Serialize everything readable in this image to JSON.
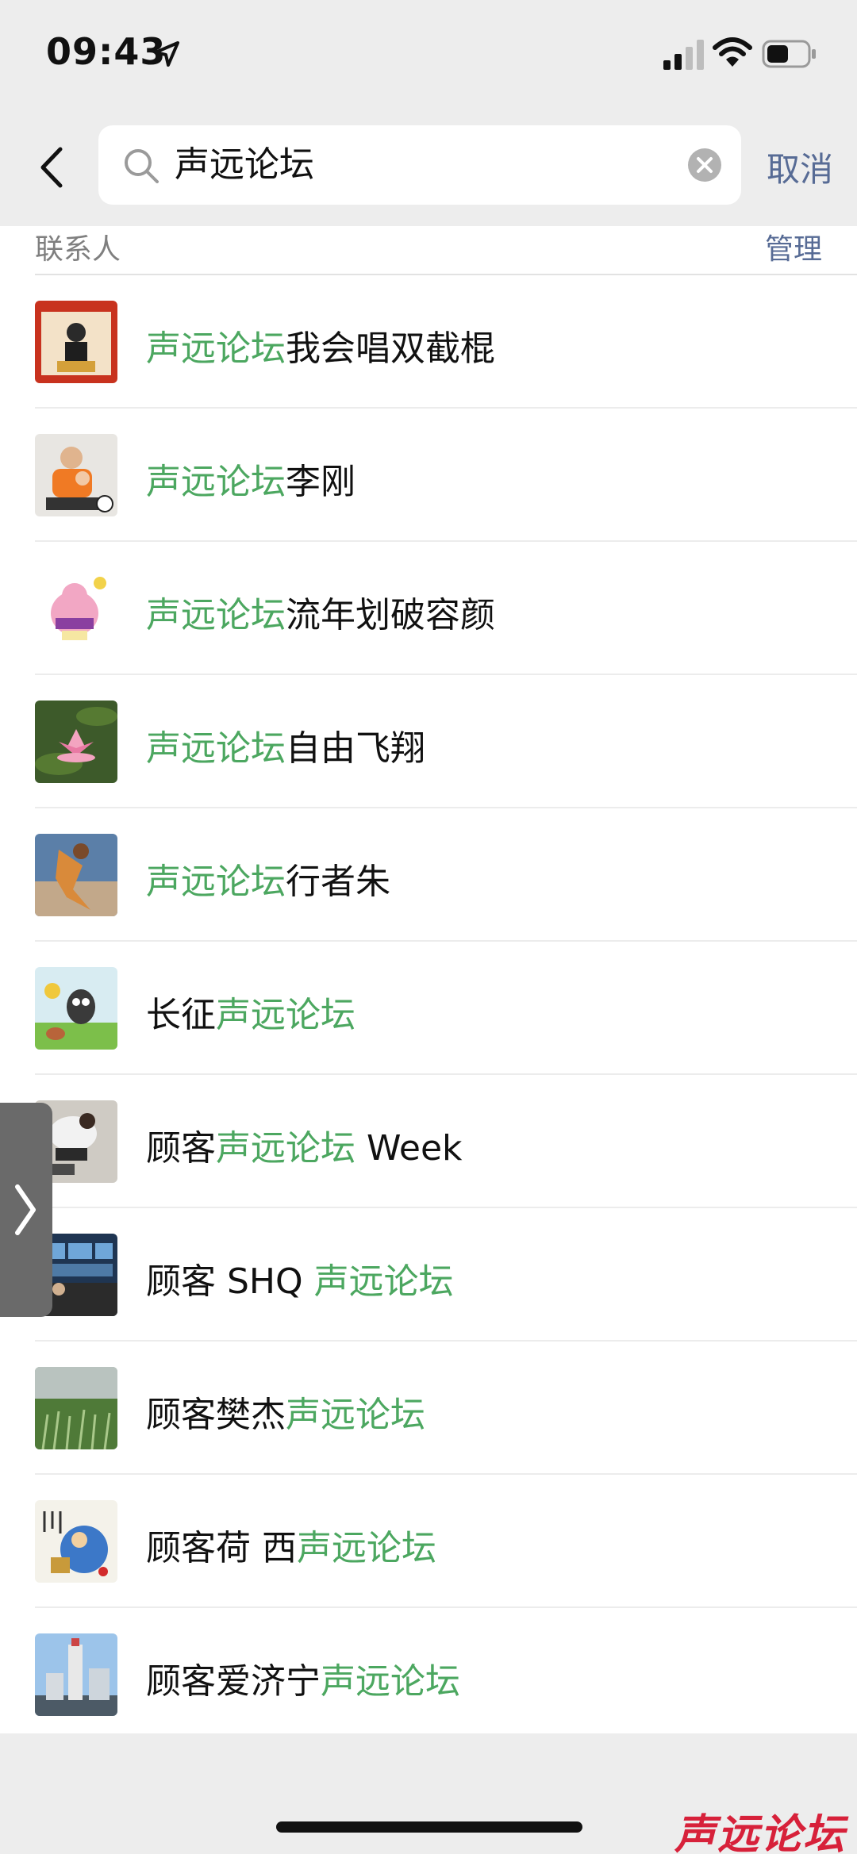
{
  "status_bar": {
    "time": "09:43"
  },
  "search": {
    "query": "声远论坛",
    "cancel_label": "取消"
  },
  "section": {
    "title": "联系人",
    "manage_label": "管理"
  },
  "contacts": [
    {
      "prefix": "",
      "highlight": "声远论坛",
      "suffix": "我会唱双截棍",
      "avatar": "red-portrait"
    },
    {
      "prefix": "",
      "highlight": "声远论坛",
      "suffix": "李刚",
      "avatar": "child-with-ball"
    },
    {
      "prefix": "",
      "highlight": "声远论坛",
      "suffix": "流年划破容颜",
      "avatar": "cartoon-character"
    },
    {
      "prefix": "",
      "highlight": "声远论坛",
      "suffix": "自由飞翔",
      "avatar": "lotus-flower"
    },
    {
      "prefix": "",
      "highlight": "声远论坛",
      "suffix": "行者朱",
      "avatar": "action-photo"
    },
    {
      "prefix": "长征",
      "highlight": "声远论坛",
      "suffix": "",
      "avatar": "cartoon-mole"
    },
    {
      "prefix": "顾客",
      "highlight": "声远论坛",
      "suffix": " Week",
      "avatar": "person-crouching"
    },
    {
      "prefix": "顾客 SHQ ",
      "highlight": "声远论坛",
      "suffix": "",
      "avatar": "control-room"
    },
    {
      "prefix": "顾客樊杰",
      "highlight": "声远论坛",
      "suffix": "",
      "avatar": "grass-field"
    },
    {
      "prefix": "顾客荷 西",
      "highlight": "声远论坛",
      "suffix": "",
      "avatar": "ink-painting"
    },
    {
      "prefix": "顾客爱济宁",
      "highlight": "声远论坛",
      "suffix": "",
      "avatar": "city-tower"
    }
  ],
  "watermark": "声远论坛",
  "colors": {
    "highlight": "#4ca760",
    "link": "#576b95",
    "background": "#ededed"
  }
}
